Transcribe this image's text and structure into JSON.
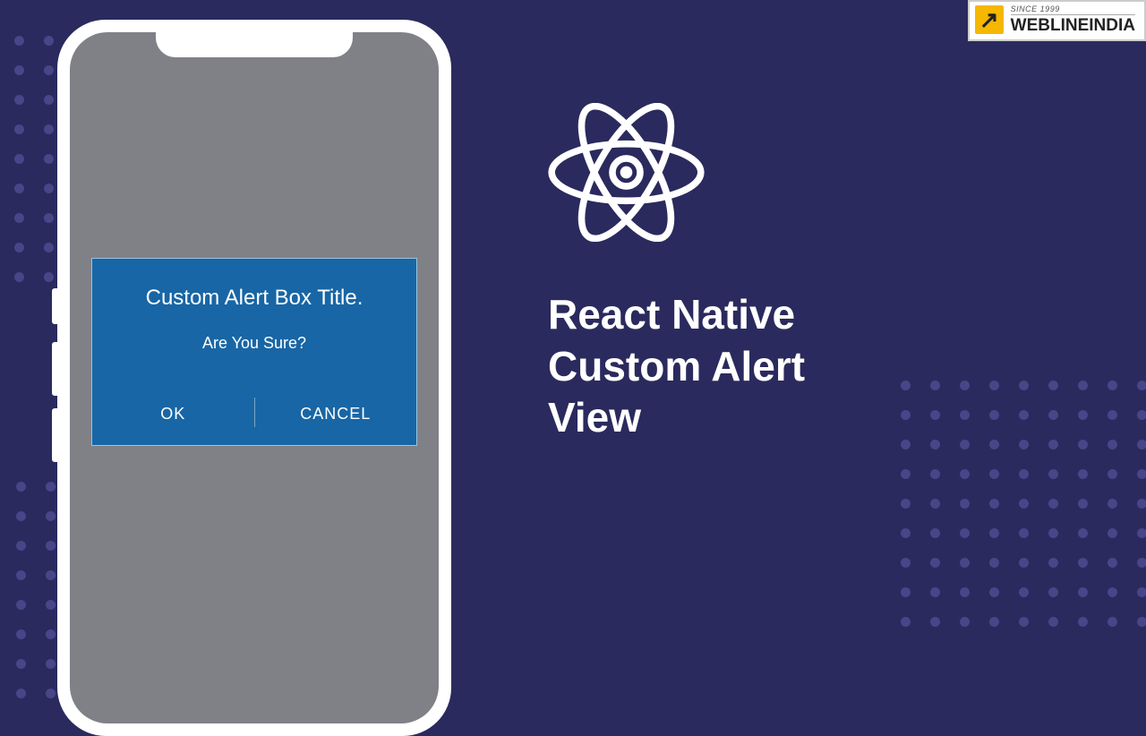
{
  "alert": {
    "title": "Custom Alert Box Title.",
    "message": "Are You Sure?",
    "ok_label": "OK",
    "cancel_label": "CANCEL"
  },
  "heading": {
    "line1": "React Native",
    "line2": "Custom Alert",
    "line3": "View"
  },
  "logo": {
    "since": "SINCE 1999",
    "name": "WEBLINEINDIA"
  },
  "colors": {
    "background": "#2a2a5e",
    "alert_bg": "#1866a5",
    "phone_screen": "#808187",
    "logo_arrow": "#f5b700"
  }
}
